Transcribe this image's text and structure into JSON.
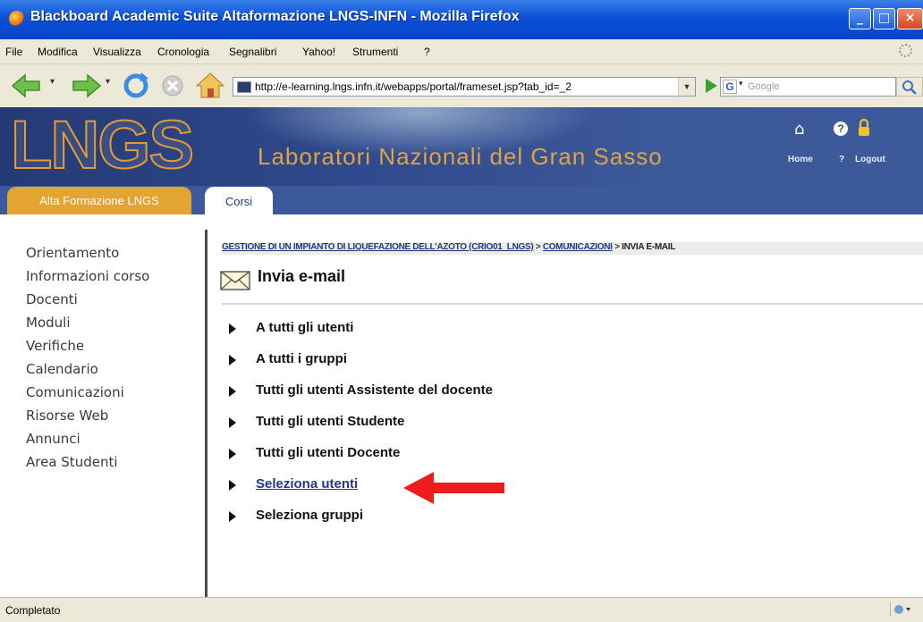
{
  "window": {
    "title": "Blackboard Academic Suite Altaformazione LNGS-INFN - Mozilla Firefox",
    "controls": {
      "minimize": "_",
      "maximize": "□",
      "close": "×"
    }
  },
  "menubar": {
    "items": [
      "File",
      "Modifica",
      "Visualizza",
      "Cronologia",
      "Segnalibri",
      "Yahoo!",
      "Strumenti",
      "?"
    ]
  },
  "navbar": {
    "url": "http://e-learning.lngs.infn.it/webapps/portal/frameset.jsp?tab_id=_2",
    "search_placeholder": "Google",
    "search_engine_letter": "G"
  },
  "banner": {
    "logo": "LNGS",
    "tagline": "Laboratori Nazionali del Gran Sasso",
    "links": {
      "home": "Home",
      "help": "?",
      "logout": "Logout"
    }
  },
  "tabs": [
    {
      "label": "Alta Formazione LNGS",
      "active": false
    },
    {
      "label": "Corsi",
      "active": true
    }
  ],
  "leftnav": {
    "items": [
      "Orientamento",
      "Informazioni corso",
      "Docenti",
      "Moduli",
      "Verifiche",
      "Calendario",
      "Comunicazioni",
      "Risorse Web",
      "Annunci",
      "Area Studenti"
    ]
  },
  "breadcrumb": {
    "items": [
      "GESTIONE DI UN IMPIANTO DI LIQUEFAZIONE DELL'AZOTO (CRIO01_LNGS)",
      "COMUNICAZIONI"
    ],
    "separator": " > ",
    "current": "INVIA E-MAIL"
  },
  "page": {
    "title": "Invia e-mail"
  },
  "options": [
    {
      "label": "A tutti gli utenti"
    },
    {
      "label": "A tutti i gruppi"
    },
    {
      "label": "Tutti gli utenti Assistente del docente"
    },
    {
      "label": "Tutti gli utenti Studente"
    },
    {
      "label": "Tutti gli utenti Docente"
    },
    {
      "label": "Seleziona utenti"
    },
    {
      "label": "Seleziona gruppi"
    }
  ],
  "statusbar": {
    "text": "Completato"
  },
  "colors": {
    "banner_blue": "#3c5a9b",
    "tab_orange": "#e3a431",
    "annotation_arrow": "#ee1c1c",
    "link_blue": "#1f3a8a"
  }
}
